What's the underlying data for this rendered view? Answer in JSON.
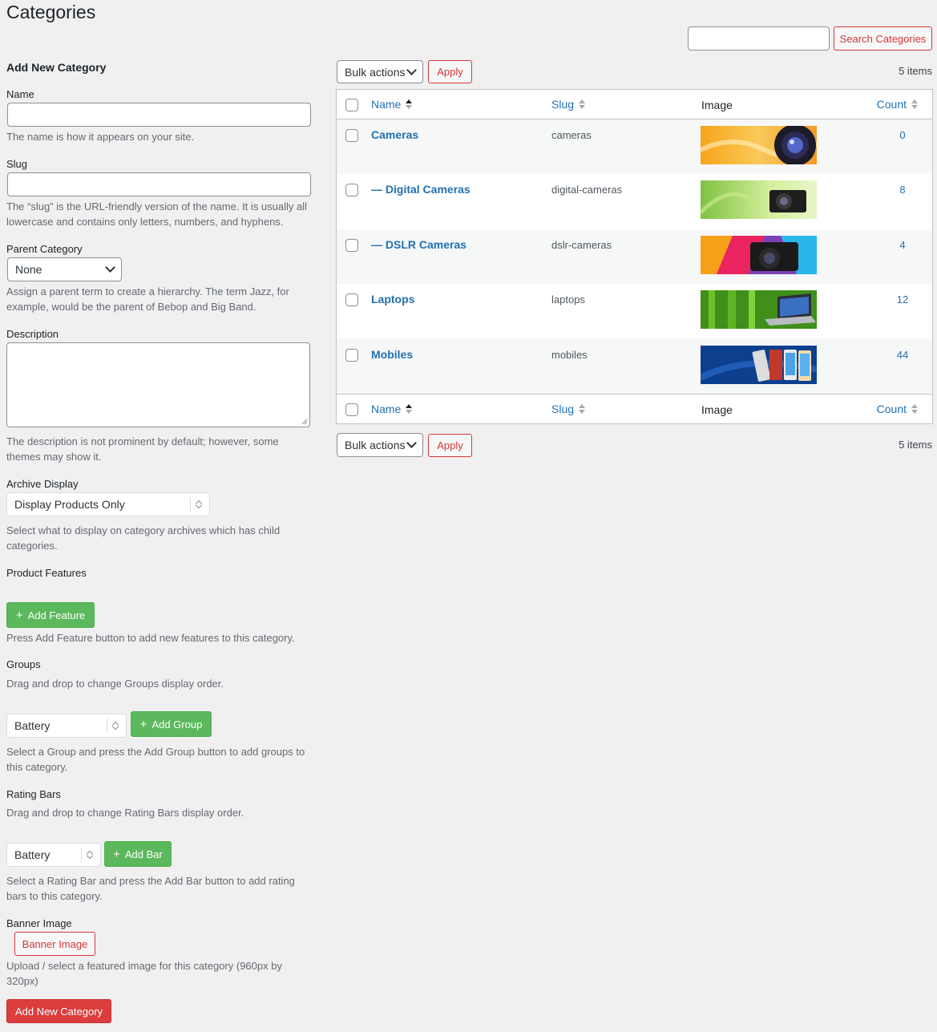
{
  "page": {
    "title": "Categories"
  },
  "search": {
    "placeholder": "",
    "button_label": "Search Categories"
  },
  "form": {
    "heading": "Add New Category",
    "name": {
      "label": "Name",
      "value": "",
      "help": "The name is how it appears on your site."
    },
    "slug": {
      "label": "Slug",
      "value": "",
      "help": "The “slug” is the URL-friendly version of the name. It is usually all lowercase and contains only letters, numbers, and hyphens."
    },
    "parent": {
      "label": "Parent Category",
      "selected": "None",
      "help": "Assign a parent term to create a hierarchy. The term Jazz, for example, would be the parent of Bebop and Big Band."
    },
    "description": {
      "label": "Description",
      "value": "",
      "help": "The description is not prominent by default; however, some themes may show it."
    },
    "archive_display": {
      "label": "Archive Display",
      "selected": "Display Products Only",
      "help": "Select what to display on category archives which has child categories."
    },
    "product_features": {
      "label": "Product Features",
      "button_label": "Add Feature",
      "help": "Press Add Feature button to add new features to this category."
    },
    "groups": {
      "label": "Groups",
      "drag_help": "Drag and drop to change Groups display order.",
      "selected": "Battery",
      "button_label": "Add Group",
      "help": "Select a Group and press the Add Group button to add groups to this category."
    },
    "rating_bars": {
      "label": "Rating Bars",
      "drag_help": "Drag and drop to change Rating Bars display order.",
      "selected": "Battery",
      "button_label": "Add Bar",
      "help": "Select a Rating Bar and press the Add Bar button to add rating bars to this category."
    },
    "banner": {
      "label": "Banner Image",
      "button_label": "Banner Image",
      "help": "Upload / select a featured image for this category (960px by 320px)"
    },
    "submit_label": "Add New Category"
  },
  "list": {
    "bulk_actions": "Bulk actions",
    "apply_label": "Apply",
    "items_count": "5 items",
    "columns": {
      "name": "Name",
      "slug": "Slug",
      "image": "Image",
      "count": "Count"
    },
    "rows": [
      {
        "name": "Cameras",
        "slug": "cameras",
        "count": "0",
        "image": "camera-lens-banner"
      },
      {
        "name": "— Digital Cameras",
        "slug": "digital-cameras",
        "count": "8",
        "image": "digital-camera-banner"
      },
      {
        "name": "— DSLR Cameras",
        "slug": "dslr-cameras",
        "count": "4",
        "image": "dslr-camera-banner"
      },
      {
        "name": "Laptops",
        "slug": "laptops",
        "count": "12",
        "image": "laptop-banner"
      },
      {
        "name": "Mobiles",
        "slug": "mobiles",
        "count": "44",
        "image": "mobiles-banner"
      }
    ]
  }
}
